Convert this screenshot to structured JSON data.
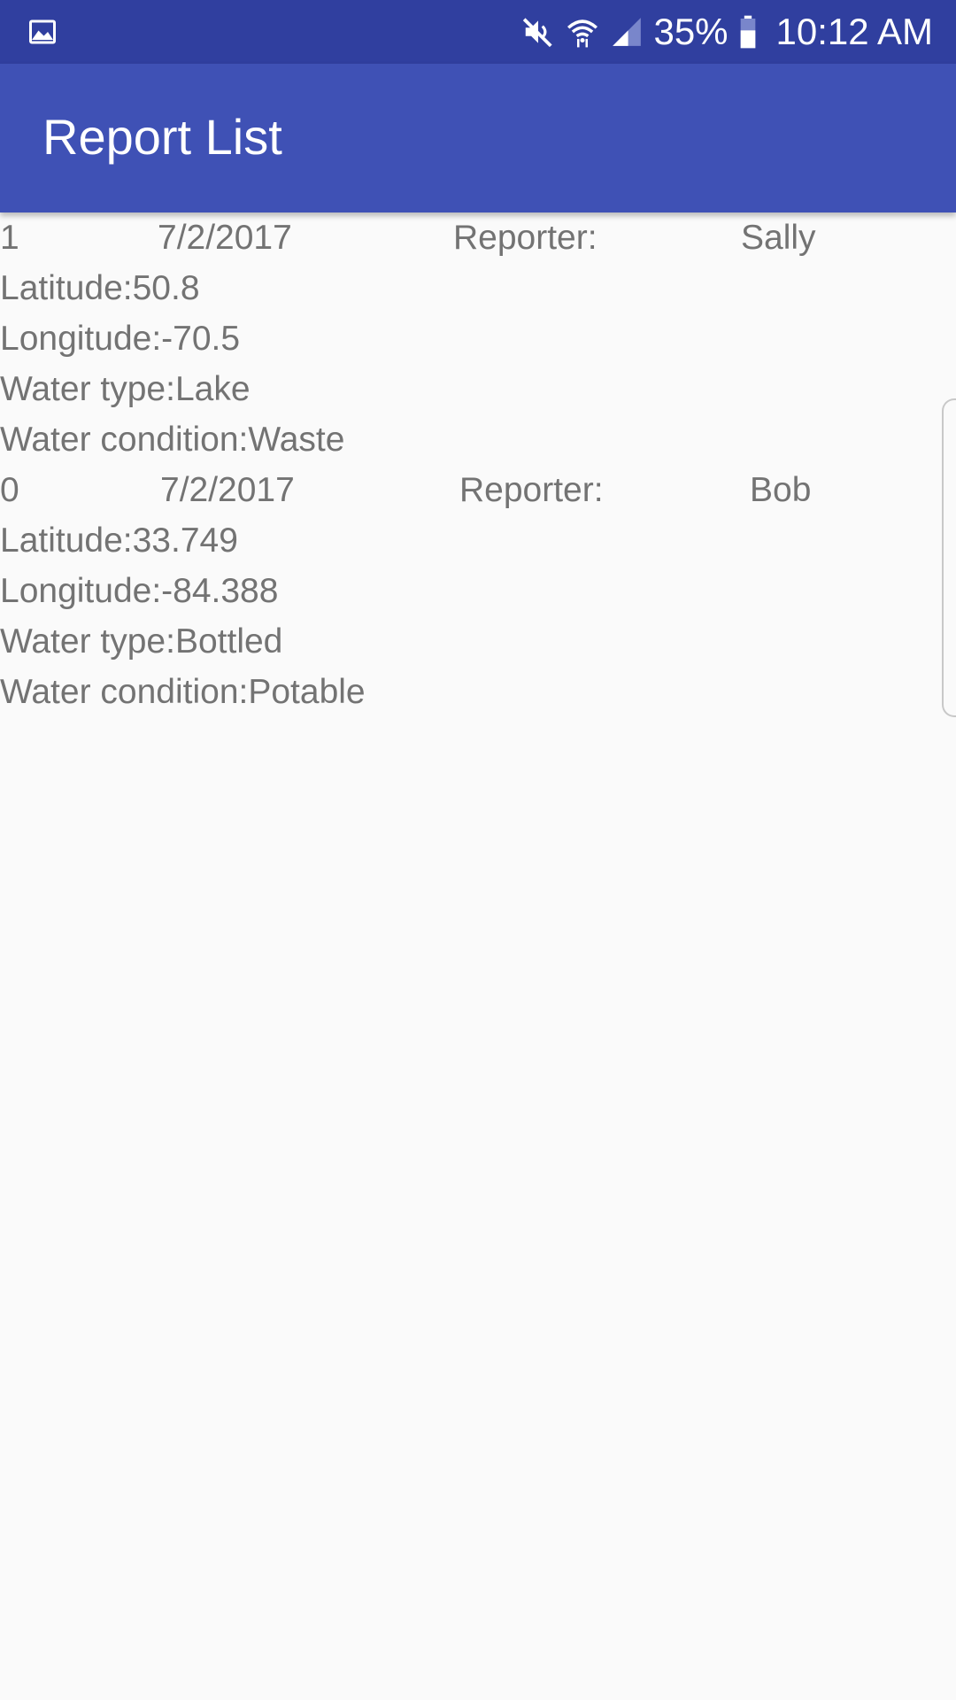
{
  "status_bar": {
    "battery_percent": "35%",
    "time": "10:12 AM",
    "icons": [
      "gallery-icon",
      "mute-icon",
      "wifi-icon",
      "signal-icon",
      "battery-icon"
    ]
  },
  "app_bar": {
    "title": "Report List"
  },
  "reports": [
    {
      "id": "1",
      "date": "7/2/2017",
      "reporter_label": "Reporter:",
      "reporter_name": "Sally",
      "latitude": "Latitude:50.8",
      "longitude": "Longitude:-70.5",
      "water_type": "Water type:Lake",
      "water_condition": "Water condition:Waste"
    },
    {
      "id": "0",
      "date": "7/2/2017",
      "reporter_label": "Reporter:",
      "reporter_name": "Bob",
      "latitude": "Latitude:33.749",
      "longitude": "Longitude:-84.388",
      "water_type": "Water type:Bottled",
      "water_condition": "Water condition:Potable"
    }
  ],
  "colors": {
    "status_bar": "#303f9f",
    "app_bar": "#3f51b5",
    "background": "#fafafa",
    "text": "#737373"
  }
}
